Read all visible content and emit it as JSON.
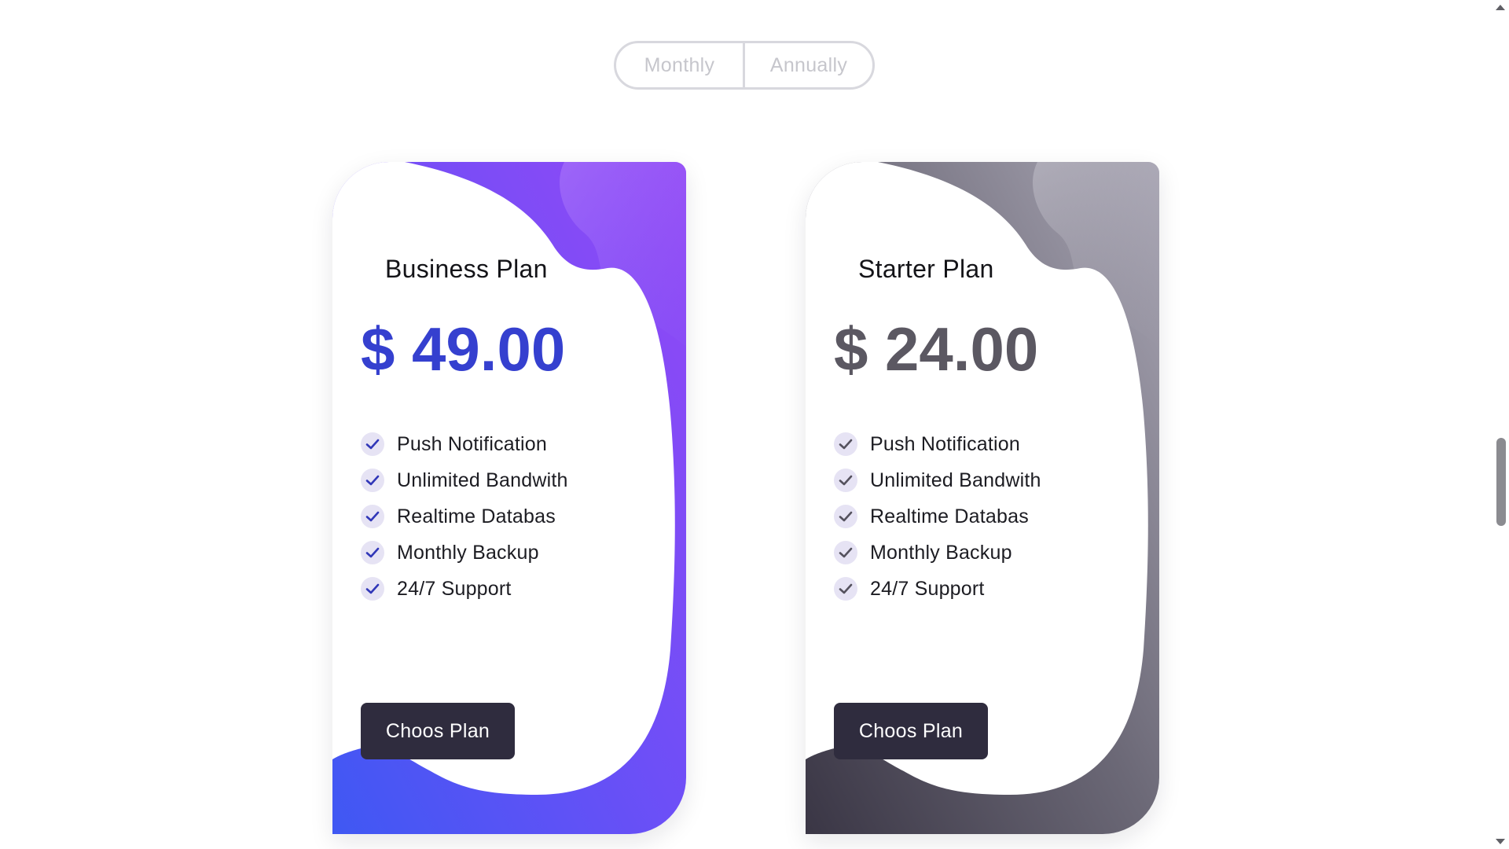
{
  "billing_toggle": {
    "options": [
      "Monthly",
      "Annually"
    ]
  },
  "plans": [
    {
      "title": "Business Plan",
      "price": "$ 49.00",
      "price_color": "#3540cf",
      "check_color": "#3137b8",
      "theme": "purple",
      "features": [
        "Push Notification",
        "Unlimited Bandwith",
        "Realtime Databas",
        "Monthly Backup",
        "24/7 Support"
      ],
      "button_label": "Choos Plan"
    },
    {
      "title": "Starter Plan",
      "price": "$ 24.00",
      "price_color": "#5b5862",
      "check_color": "#55525e",
      "theme": "gray",
      "features": [
        "Push Notification",
        "Unlimited Bandwith",
        "Realtime Databas",
        "Monthly Backup",
        "24/7 Support"
      ],
      "button_label": "Choos Plan"
    }
  ],
  "colors": {
    "purple_gradient": [
      "#3f58f3",
      "#6d4ff7",
      "#9448f5"
    ],
    "gray_gradient": [
      "#3a3645",
      "#6c6977",
      "#aaa7b5"
    ],
    "button_bg": "#2f2c3e"
  }
}
